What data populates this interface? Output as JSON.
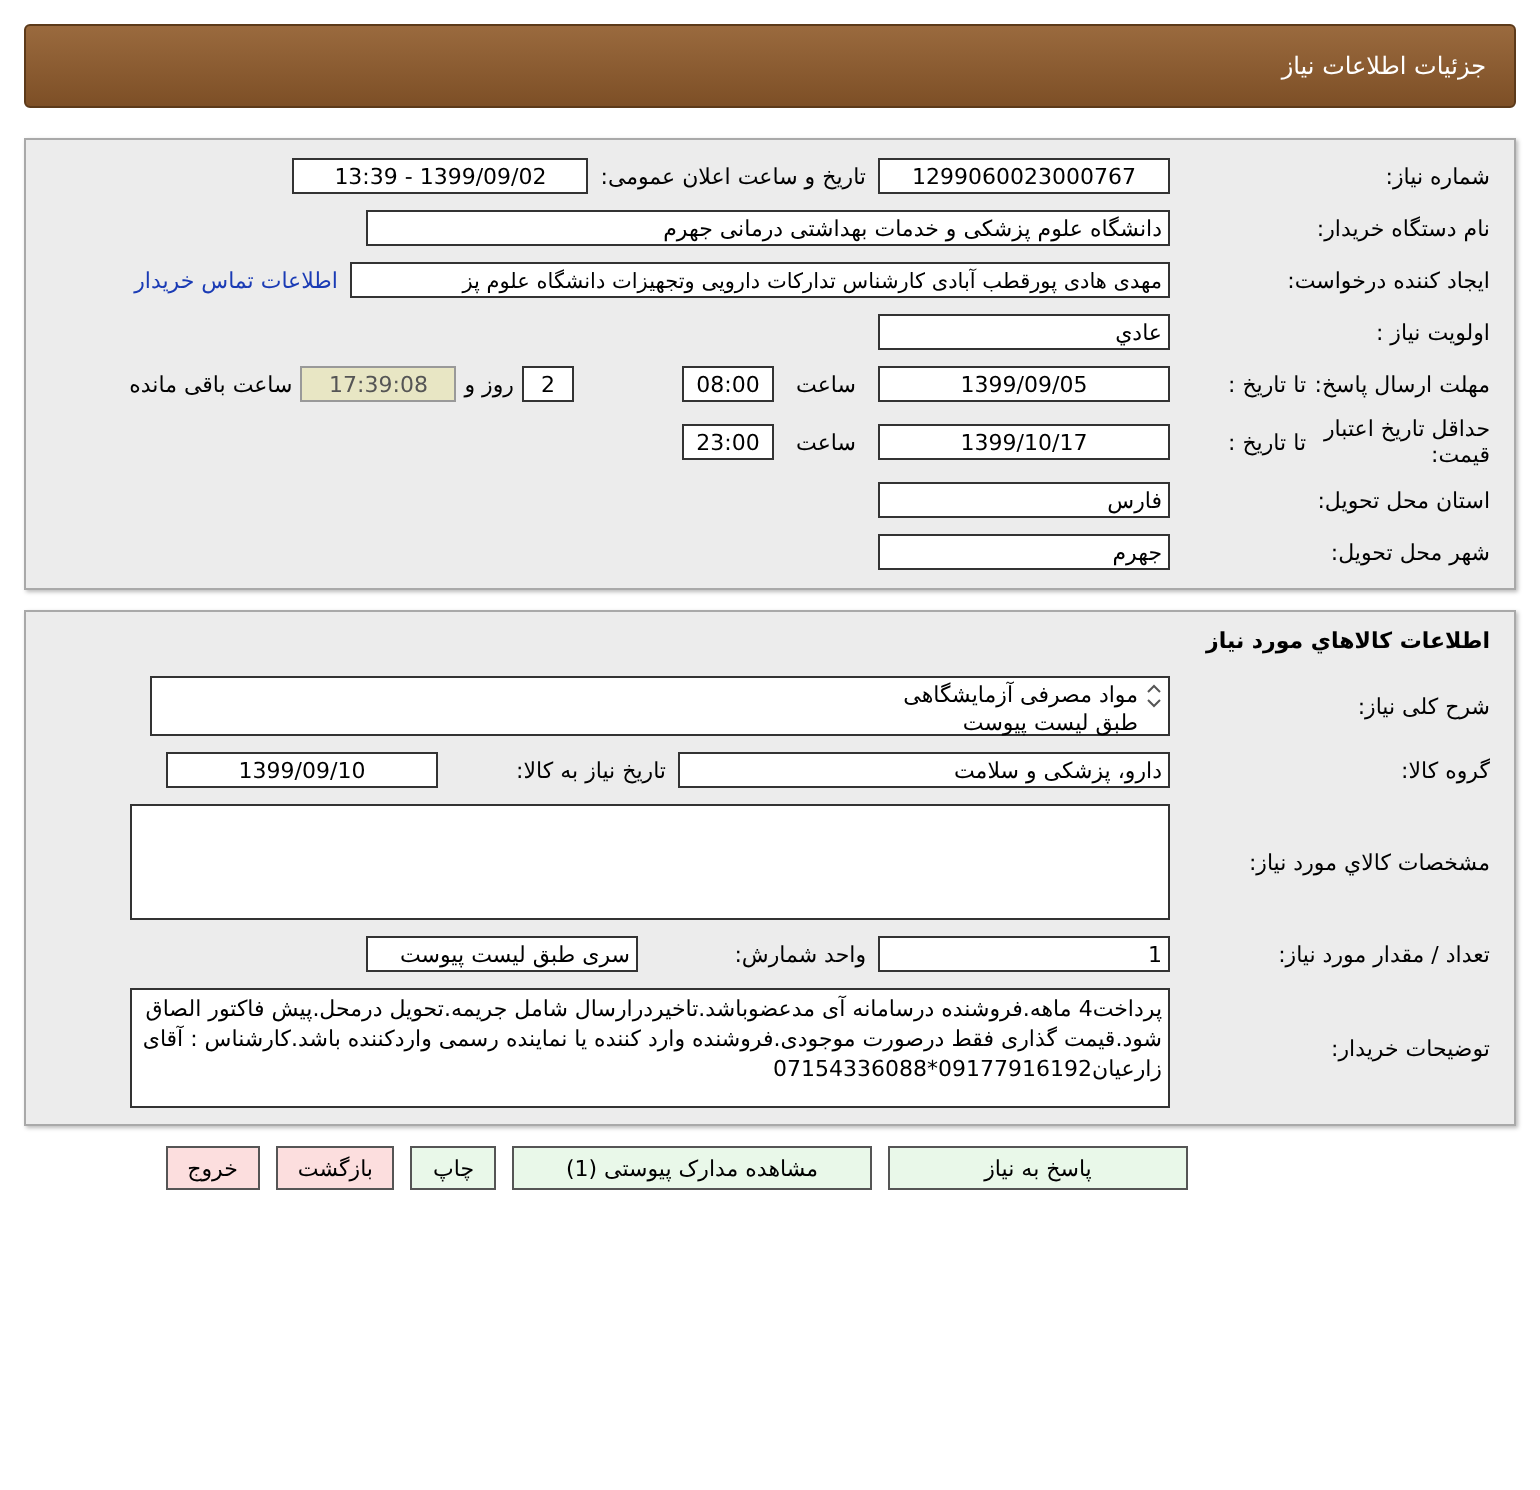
{
  "header": {
    "title": "جزئیات اطلاعات نیاز"
  },
  "need_number": {
    "label": "شماره نیاز:",
    "value": "1299060023000767"
  },
  "announce": {
    "label": "تاریخ و ساعت اعلان عمومی:",
    "value": "1399/09/02 - 13:39"
  },
  "buyer_org": {
    "label": "نام دستگاه خریدار:",
    "value": "دانشگاه علوم پزشکی و خدمات بهداشتی درمانی جهرم"
  },
  "requester": {
    "label": "ایجاد کننده درخواست:",
    "value": "مهدی هادی پورقطب آبادی کارشناس تدارکات دارویی وتجهیزات دانشگاه علوم پز",
    "link": "اطلاعات تماس خریدار"
  },
  "priority": {
    "label": "اولویت نیاز :",
    "value": "عادي"
  },
  "deadline": {
    "label": "مهلت ارسال پاسخ:",
    "date_label": "تا تاریخ :",
    "date": "1399/09/05",
    "time_label": "ساعت",
    "time": "08:00",
    "days": "2",
    "days_label": "روز و",
    "remaining": "17:39:08",
    "remaining_label": "ساعت باقی مانده"
  },
  "validity": {
    "label": "حداقل تاریخ اعتبار قیمت:",
    "date_label": "تا تاریخ :",
    "date": "1399/10/17",
    "time_label": "ساعت",
    "time": "23:00"
  },
  "province": {
    "label": "استان محل تحویل:",
    "value": "فارس"
  },
  "city": {
    "label": "شهر محل تحویل:",
    "value": "جهرم"
  },
  "goods": {
    "title": "اطلاعات کالاهاي مورد نیاز",
    "description": {
      "label": "شرح کلی نیاز:",
      "lines": [
        "مواد مصرفی آزمایشگاهی",
        "طبق لیست پیوست"
      ]
    },
    "group": {
      "label": "گروه کالا:",
      "value": "دارو، پزشکی و سلامت",
      "date_label": "تاریخ نیاز به کالا:",
      "date": "1399/09/10"
    },
    "specs": {
      "label": "مشخصات کالاي مورد نیاز:"
    },
    "quantity": {
      "label": "تعداد / مقدار مورد نیاز:",
      "value": "1",
      "unit_label": "واحد شمارش:",
      "unit": "سری طبق لیست پیوست"
    },
    "notes": {
      "label": "توضیحات خریدار:",
      "value": "پرداخت4 ماهه.فروشنده درسامانه آی مدعضوباشد.تاخیردرارسال شامل جریمه.تحویل درمحل.پیش فاکتور الصاق شود.قیمت گذاری فقط درصورت موجودی.فروشنده وارد کننده یا نماینده رسمی واردکننده باشد.کارشناس : آقای زارعیان09177916192*07154336088"
    }
  },
  "buttons": [
    {
      "label": "پاسخ به نیاز",
      "kind": "action"
    },
    {
      "label": "مشاهده مدارک پیوستی (1)",
      "kind": "action"
    },
    {
      "label": "چاپ",
      "kind": "action"
    },
    {
      "label": "بازگشت",
      "kind": "exit"
    },
    {
      "label": "خروج",
      "kind": "exit"
    }
  ]
}
